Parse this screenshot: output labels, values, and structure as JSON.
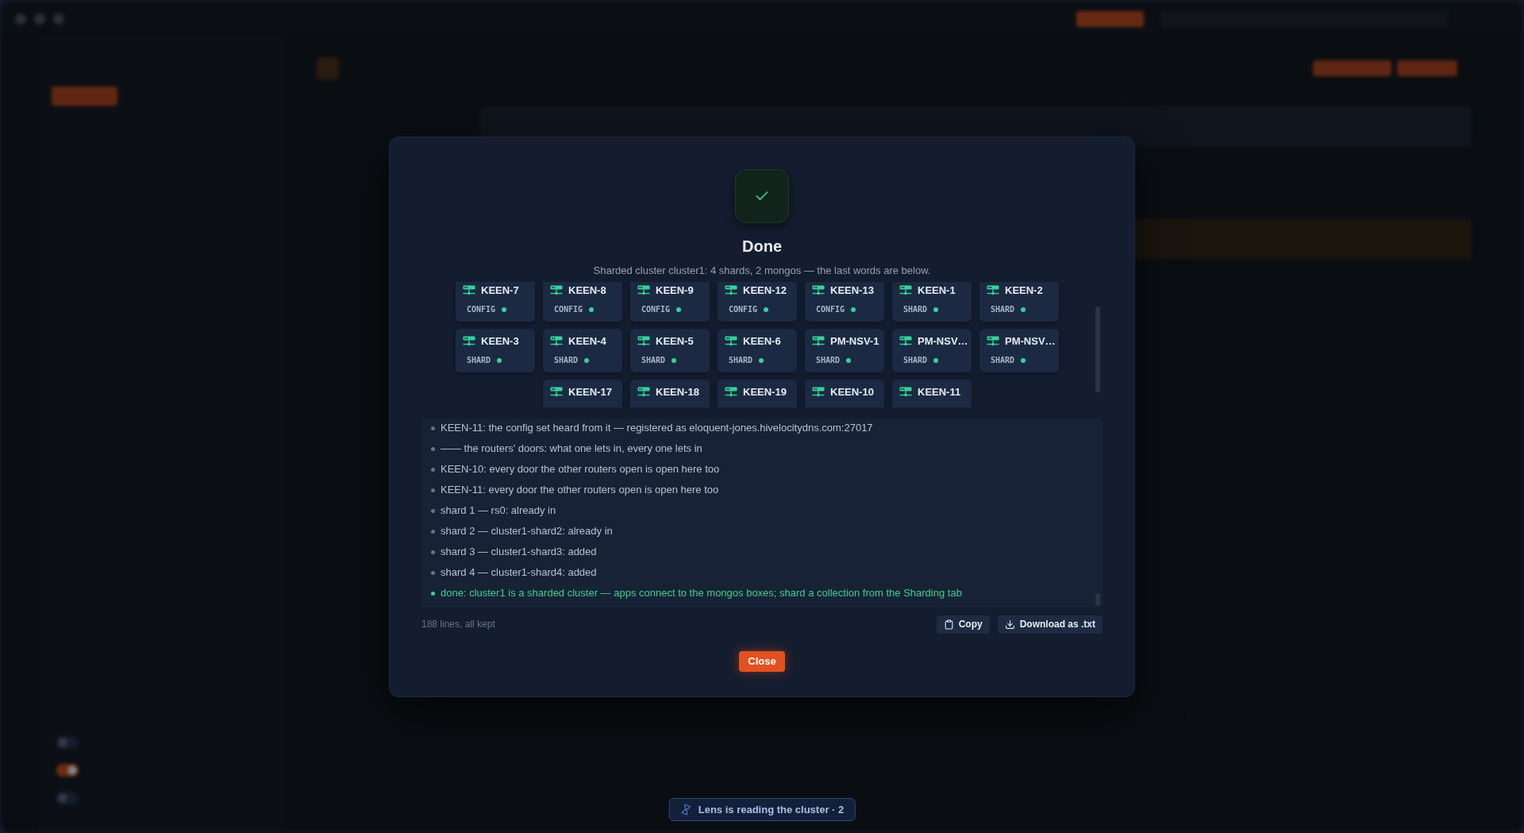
{
  "background": {
    "toggles": [
      {
        "on": false
      },
      {
        "on": true
      },
      {
        "on": false
      }
    ]
  },
  "dialog": {
    "title": "Done",
    "subtitle": "Sharded cluster cluster1: 4 shards, 2 mongos — the last words are below.",
    "nodes": [
      {
        "name": "KEEN-7",
        "role": "CONFIG",
        "color": "#34d399"
      },
      {
        "name": "KEEN-8",
        "role": "CONFIG",
        "color": "#34d399"
      },
      {
        "name": "KEEN-9",
        "role": "CONFIG",
        "color": "#34d399"
      },
      {
        "name": "KEEN-12",
        "role": "CONFIG",
        "color": "#34d399"
      },
      {
        "name": "KEEN-13",
        "role": "CONFIG",
        "color": "#34d399"
      },
      {
        "name": "KEEN-1",
        "role": "SHARD",
        "color": "#34d399"
      },
      {
        "name": "KEEN-2",
        "role": "SHARD",
        "color": "#34d399"
      },
      {
        "name": "KEEN-3",
        "role": "SHARD",
        "color": "#34d399"
      },
      {
        "name": "KEEN-4",
        "role": "SHARD",
        "color": "#34d399"
      },
      {
        "name": "KEEN-5",
        "role": "SHARD",
        "color": "#34d399"
      },
      {
        "name": "KEEN-6",
        "role": "SHARD",
        "color": "#34d399"
      },
      {
        "name": "PM-NSV-1",
        "role": "SHARD",
        "color": "#34d399"
      },
      {
        "name": "PM-NSV…",
        "role": "SHARD",
        "color": "#34d399"
      },
      {
        "name": "PM-NSV…",
        "role": "SHARD",
        "color": "#34d399"
      },
      {
        "name": "KEEN-17"
      },
      {
        "name": "KEEN-18"
      },
      {
        "name": "KEEN-19"
      },
      {
        "name": "KEEN-10"
      },
      {
        "name": "KEEN-11"
      }
    ],
    "log": [
      {
        "kind": "info",
        "text": "KEEN-11: the config set heard from it — registered as eloquent-jones.hivelocitydns.com:27017"
      },
      {
        "kind": "info",
        "text": "—— the routers' doors: what one lets in, every one lets in"
      },
      {
        "kind": "info",
        "text": "KEEN-10: every door the other routers open is open here too"
      },
      {
        "kind": "info",
        "text": "KEEN-11: every door the other routers open is open here too"
      },
      {
        "kind": "info",
        "text": "shard 1 — rs0: already in"
      },
      {
        "kind": "info",
        "text": "shard 2 — cluster1-shard2: already in"
      },
      {
        "kind": "info",
        "text": "shard 3 — cluster1-shard3: added"
      },
      {
        "kind": "info",
        "text": "shard 4 — cluster1-shard4: added"
      },
      {
        "kind": "success",
        "text": "done: cluster1 is a sharded cluster — apps connect to the mongos boxes; shard a collection from the Sharding tab"
      }
    ],
    "line_count": "188 lines, all kept",
    "copy_button": "Copy",
    "download_button": "Download as .txt",
    "close_button": "Close"
  },
  "toast": {
    "text": "Lens is reading the cluster · 2"
  }
}
